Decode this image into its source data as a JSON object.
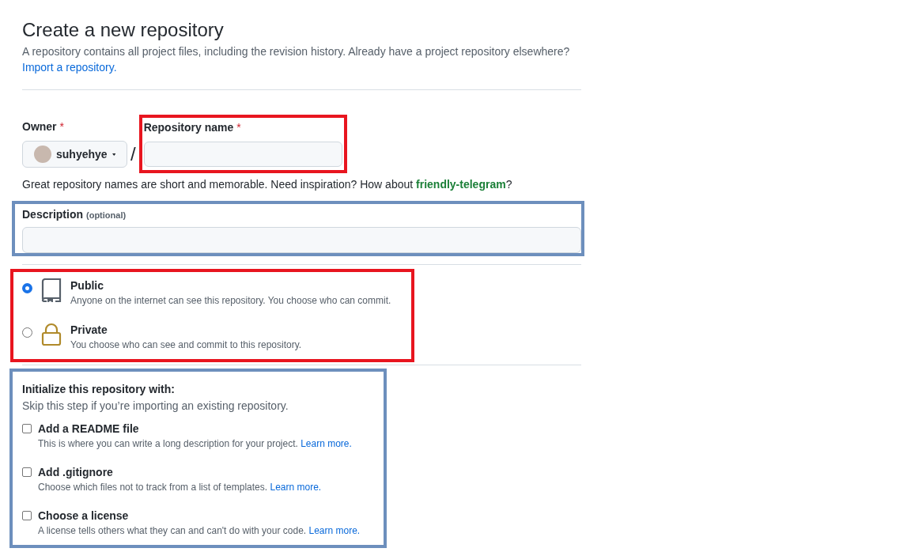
{
  "header": {
    "title": "Create a new repository",
    "intro": "A repository contains all project files, including the revision history. Already have a project repository elsewhere?",
    "import_link": "Import a repository."
  },
  "owner": {
    "label": "Owner",
    "required_mark": "*",
    "value": "suhyehye"
  },
  "separator": "/",
  "repo_name": {
    "label": "Repository name",
    "required_mark": "*",
    "color": "#e8151f"
  },
  "name_hint": {
    "text": "Great repository names are short and memorable. Need inspiration? How about ",
    "suggestion": "friendly-telegram",
    "end": "?"
  },
  "description": {
    "label": "Description",
    "note": "(optional)",
    "color": "#6d8fbd"
  },
  "visibility": {
    "color": "#e8151f",
    "options": [
      {
        "kind": "public",
        "label": "Public",
        "detail": "Anyone on the internet can see this repository. You choose who can commit.",
        "selected": true
      },
      {
        "kind": "private",
        "label": "Private",
        "detail": "You choose who can see and commit to this repository.",
        "selected": false
      }
    ]
  },
  "initialize": {
    "color": "#6d8fbd",
    "title": "Initialize this repository with:",
    "subtitle": "Skip this step if you’re importing an existing repository.",
    "options": [
      {
        "label": "Add a README file",
        "detail": "This is where you can write a long description for your project.",
        "link": "Learn more.",
        "checked": false
      },
      {
        "label": "Add .gitignore",
        "detail": "Choose which files not to track from a list of templates.",
        "link": "Learn more.",
        "checked": false
      },
      {
        "label": "Choose a license",
        "detail": "A license tells others what they can and can't do with your code.",
        "link": "Learn more.",
        "checked": false
      }
    ]
  }
}
